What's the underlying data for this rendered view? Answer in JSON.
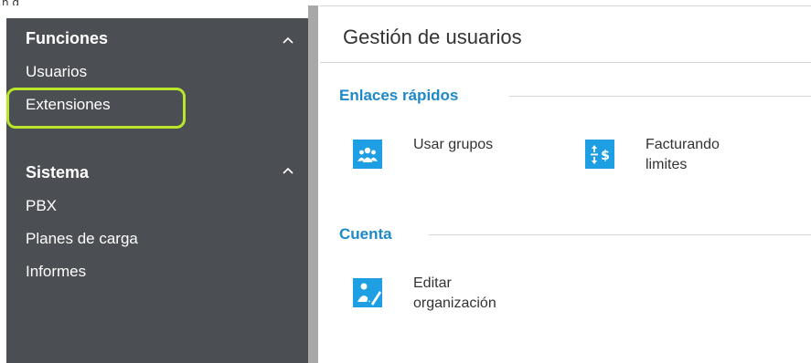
{
  "top_fragment": "n g",
  "sidebar": {
    "sections": [
      {
        "title": "Funciones",
        "items": [
          "Usuarios",
          "Extensiones"
        ]
      },
      {
        "title": "Sistema",
        "items": [
          "PBX",
          "Planes de carga",
          "Informes"
        ]
      }
    ]
  },
  "main": {
    "title": "Gestión de usuarios",
    "quick_links": {
      "title": "Enlaces rápidos",
      "links": [
        {
          "line1": "Usar grupos",
          "line2": "",
          "icon": "user-group-icon"
        },
        {
          "line1": "Facturando",
          "line2": "limites",
          "icon": "billing-limits-icon"
        }
      ]
    },
    "account": {
      "title": "Cuenta",
      "links": [
        {
          "line1": "Editar",
          "line2": "organización",
          "icon": "edit-organization-icon"
        }
      ]
    }
  },
  "colors": {
    "sidebar_bg": "#4b4e52",
    "accent_blue": "#1e9fe3",
    "section_title": "#1e88c9",
    "highlight": "#b9e52a"
  }
}
